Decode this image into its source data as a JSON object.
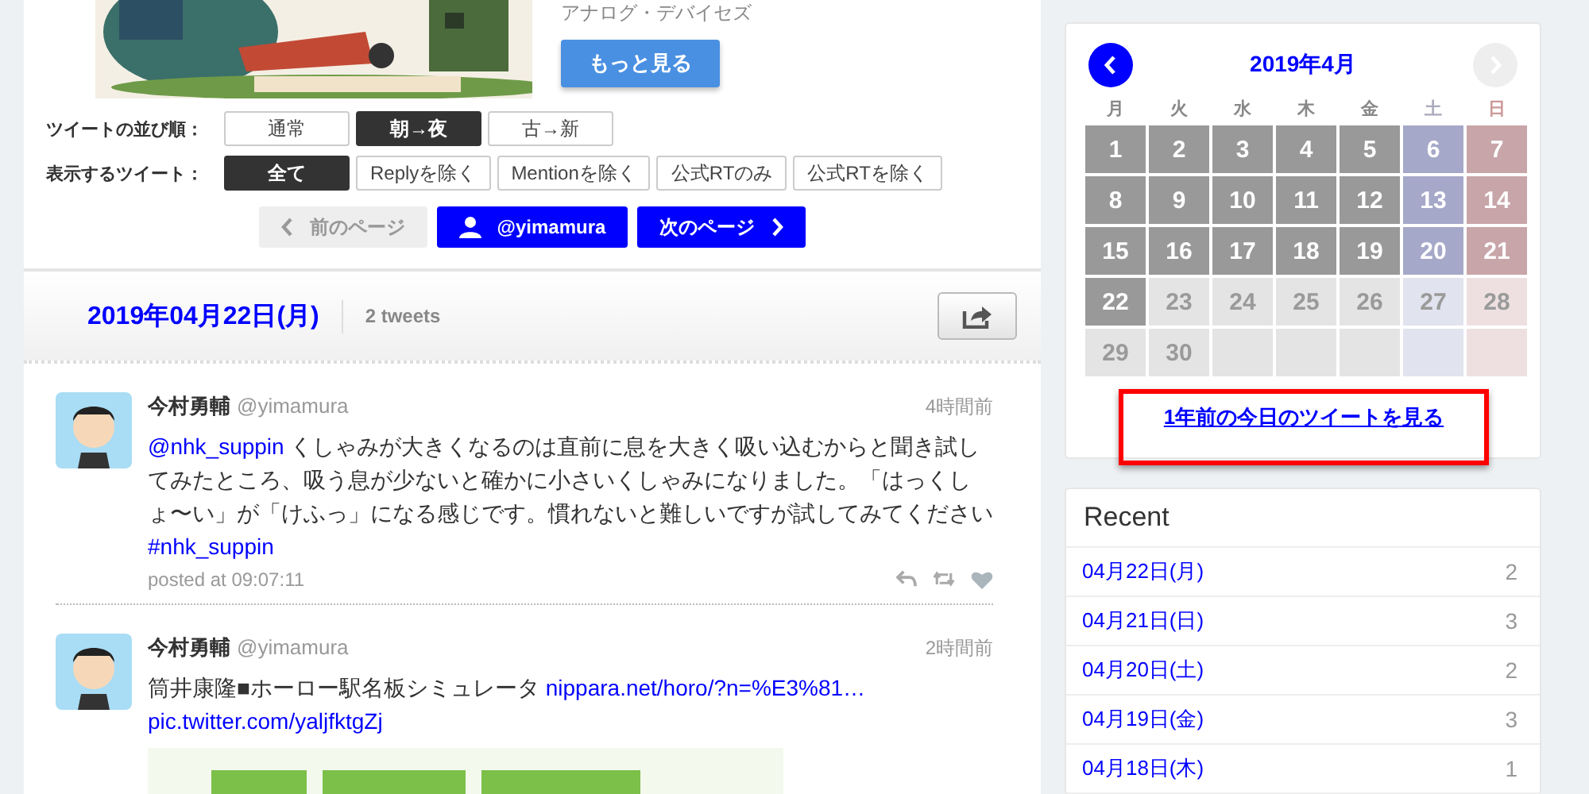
{
  "ad": {
    "sponsor": "アナログ・デバイセズ",
    "more_button": "もっと見る"
  },
  "sort": {
    "label": "ツイートの並び順：",
    "options": [
      {
        "label": "通常",
        "selected": false
      },
      {
        "label": "朝→夜",
        "selected": true
      },
      {
        "label": "古→新",
        "selected": false
      }
    ]
  },
  "filter": {
    "label": "表示するツイート：",
    "options": [
      {
        "label": "全て",
        "selected": true
      },
      {
        "label": "Replyを除く",
        "selected": false
      },
      {
        "label": "Mentionを除く",
        "selected": false
      },
      {
        "label": "公式RTのみ",
        "selected": false
      },
      {
        "label": "公式RTを除く",
        "selected": false
      }
    ]
  },
  "pager": {
    "prev": {
      "label": "前のページ",
      "disabled": true
    },
    "user": "@yimamura",
    "next": {
      "label": "次のページ",
      "disabled": false
    }
  },
  "day_header": {
    "date": "2019年04月22日(月)",
    "count": "2 tweets"
  },
  "tweets": [
    {
      "name": "今村勇輔",
      "handle": "@yimamura",
      "time": "4時間前",
      "parts": [
        {
          "text": "@nhk_suppin",
          "link": true
        },
        {
          "text": " くしゃみが大きくなるのは直前に息を大きく吸い込むからと聞き試してみたところ、吸う息が少ないと確かに小さいくしゃみになりました。「はっくしょ〜い」が「けふっ」になる感じです。慣れないと難しいですが試してみてください ",
          "link": false
        },
        {
          "text": "#nhk_suppin",
          "link": true
        }
      ],
      "posted": "posted at 09:07:11"
    },
    {
      "name": "今村勇輔",
      "handle": "@yimamura",
      "time": "2時間前",
      "parts": [
        {
          "text": "筒井康隆■ホーロー駅名板シミュレータ ",
          "link": false
        },
        {
          "text": "nippara.net/horo/?n=%E3%81…",
          "link": true
        },
        {
          "text": "pic.twitter.com/yaljfktgZj",
          "link": true
        }
      ]
    }
  ],
  "calendar": {
    "title": "2019年4月",
    "prev_enabled": true,
    "next_enabled": false,
    "weekdays": [
      {
        "label": "月",
        "kind": "weekday"
      },
      {
        "label": "火",
        "kind": "weekday"
      },
      {
        "label": "水",
        "kind": "weekday"
      },
      {
        "label": "木",
        "kind": "weekday"
      },
      {
        "label": "金",
        "kind": "weekday"
      },
      {
        "label": "土",
        "kind": "saturday"
      },
      {
        "label": "日",
        "kind": "sunday"
      }
    ],
    "weeks": [
      [
        {
          "day": "1",
          "kind": "weekday",
          "active": true
        },
        {
          "day": "2",
          "kind": "weekday",
          "active": true
        },
        {
          "day": "3",
          "kind": "weekday",
          "active": true
        },
        {
          "day": "4",
          "kind": "weekday",
          "active": true
        },
        {
          "day": "5",
          "kind": "weekday",
          "active": true
        },
        {
          "day": "6",
          "kind": "saturday",
          "active": true
        },
        {
          "day": "7",
          "kind": "sunday",
          "active": true
        }
      ],
      [
        {
          "day": "8",
          "kind": "weekday",
          "active": true
        },
        {
          "day": "9",
          "kind": "weekday",
          "active": true
        },
        {
          "day": "10",
          "kind": "weekday",
          "active": true
        },
        {
          "day": "11",
          "kind": "weekday",
          "active": true
        },
        {
          "day": "12",
          "kind": "weekday",
          "active": true
        },
        {
          "day": "13",
          "kind": "saturday",
          "active": true
        },
        {
          "day": "14",
          "kind": "sunday",
          "active": true
        }
      ],
      [
        {
          "day": "15",
          "kind": "weekday",
          "active": true
        },
        {
          "day": "16",
          "kind": "weekday",
          "active": true
        },
        {
          "day": "17",
          "kind": "weekday",
          "active": true
        },
        {
          "day": "18",
          "kind": "weekday",
          "active": true
        },
        {
          "day": "19",
          "kind": "weekday",
          "active": true
        },
        {
          "day": "20",
          "kind": "saturday",
          "active": true
        },
        {
          "day": "21",
          "kind": "sunday",
          "active": true
        }
      ],
      [
        {
          "day": "22",
          "kind": "weekday",
          "active": true
        },
        {
          "day": "23",
          "kind": "weekday",
          "active": false
        },
        {
          "day": "24",
          "kind": "weekday",
          "active": false
        },
        {
          "day": "25",
          "kind": "weekday",
          "active": false
        },
        {
          "day": "26",
          "kind": "weekday",
          "active": false
        },
        {
          "day": "27",
          "kind": "saturday",
          "active": false
        },
        {
          "day": "28",
          "kind": "sunday",
          "active": false
        }
      ],
      [
        {
          "day": "29",
          "kind": "weekday",
          "active": false
        },
        {
          "day": "30",
          "kind": "weekday",
          "active": false
        },
        {
          "kind": "weekday",
          "active": false
        },
        {
          "kind": "weekday",
          "active": false
        },
        {
          "kind": "weekday",
          "active": false
        },
        {
          "kind": "saturday",
          "active": false
        },
        {
          "kind": "sunday",
          "active": false
        }
      ]
    ],
    "year_ago_link": "1年前の今日のツイートを見る",
    "highlighted": true
  },
  "recent": {
    "title": "Recent",
    "items": [
      {
        "date": "04月22日(月)",
        "count": "2"
      },
      {
        "date": "04月21日(日)",
        "count": "3"
      },
      {
        "date": "04月20日(土)",
        "count": "2"
      },
      {
        "date": "04月19日(金)",
        "count": "3"
      },
      {
        "date": "04月18日(木)",
        "count": "1"
      }
    ]
  }
}
